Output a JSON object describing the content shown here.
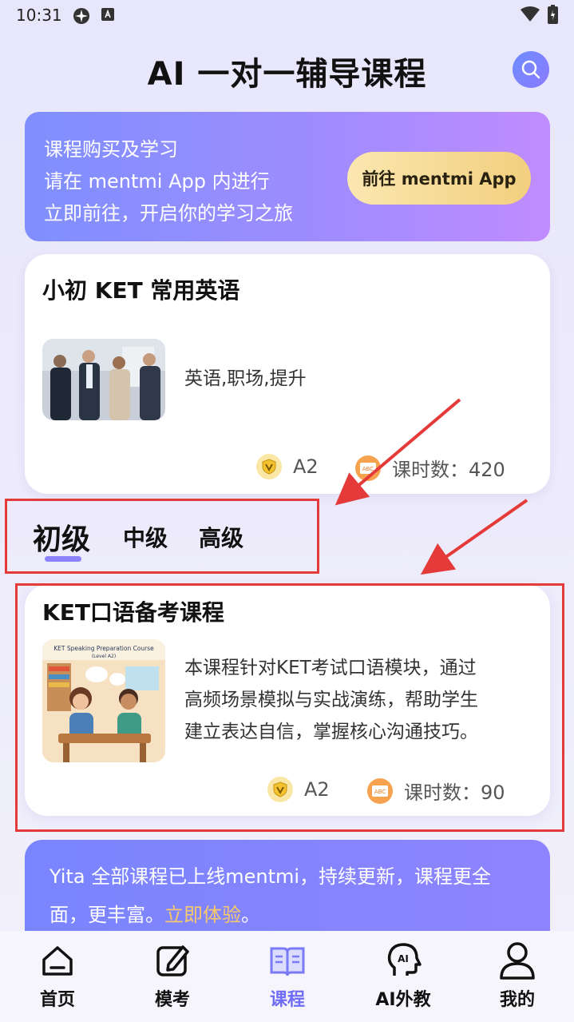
{
  "status_bar": {
    "time": "10:31"
  },
  "header": {
    "title": "AI 一对一辅导课程"
  },
  "promo": {
    "line1": "课程购买及学习",
    "line2": "请在 mentmi App 内进行",
    "line3": "立即前往，开启你的学习之旅",
    "button_label": "前往 mentmi App"
  },
  "featured_course": {
    "title": "小初 KET 常用英语",
    "tags": "英语,职场,提升",
    "level": "A2",
    "hours": "课时数：420"
  },
  "tabs": [
    {
      "label": "初级",
      "active": true
    },
    {
      "label": "中级",
      "active": false
    },
    {
      "label": "高级",
      "active": false
    }
  ],
  "course": {
    "title": "KET口语备考课程",
    "thumb_caption": "KET Speaking Preparation Course",
    "thumb_sub": "(Level A2)",
    "description_lines": [
      "本课程针对KET考试口语模块，通过",
      "高频场景模拟与实战演练，帮助学生",
      "建立表达自信，掌握核心沟通技巧。"
    ],
    "level": "A2",
    "hours": "课时数：90"
  },
  "info_banner": {
    "text": "Yita 全部课程已上线mentmi，持续更新，课程更全面，更丰富。",
    "link": "立即体验",
    "suffix": "。"
  },
  "bottom_nav": [
    {
      "label": "首页",
      "icon": "home-icon",
      "active": false
    },
    {
      "label": "模考",
      "icon": "edit-icon",
      "active": false
    },
    {
      "label": "课程",
      "icon": "book-icon",
      "active": true
    },
    {
      "label": "AI外教",
      "icon": "ai-head-icon",
      "active": false
    },
    {
      "label": "我的",
      "icon": "user-icon",
      "active": false
    }
  ],
  "colors": {
    "accent": "#6f6cf5",
    "highlight": "#e53a3a",
    "gold": "#f2cf7e"
  }
}
